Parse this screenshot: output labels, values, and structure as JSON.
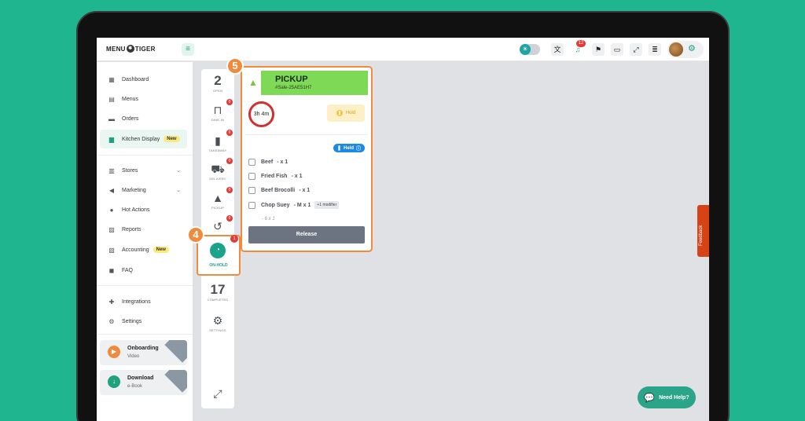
{
  "app": {
    "logo_left": "MENU",
    "logo_right": "TIGER"
  },
  "topbar": {
    "notification_count": "12",
    "icons": [
      "theme-toggle-icon",
      "translate-icon",
      "bell-icon",
      "flag-icon",
      "devices-icon",
      "fullscreen-icon",
      "document-icon",
      "settings-icon"
    ]
  },
  "sidebar": {
    "items": [
      {
        "label": "Dashboard",
        "icon": "dashboard-icon"
      },
      {
        "label": "Menus",
        "icon": "menus-icon"
      },
      {
        "label": "Orders",
        "icon": "orders-icon"
      },
      {
        "label": "Kitchen Display",
        "icon": "kitchen-icon",
        "badge": "New",
        "active": true
      },
      {
        "label": "Stores",
        "icon": "stores-icon"
      },
      {
        "label": "Marketing",
        "icon": "marketing-icon"
      },
      {
        "label": "Hot Actions",
        "icon": "hot-actions-icon"
      },
      {
        "label": "Reports",
        "icon": "reports-icon"
      },
      {
        "label": "Accounting",
        "icon": "accounting-icon",
        "badge": "New"
      },
      {
        "label": "FAQ",
        "icon": "faq-icon"
      },
      {
        "label": "Integrations",
        "icon": "integrations-icon"
      },
      {
        "label": "Settings",
        "icon": "settings-icon"
      }
    ],
    "promos": [
      {
        "title": "Onboarding",
        "subtitle": "Video"
      },
      {
        "title": "Download",
        "subtitle": "e-Book"
      }
    ]
  },
  "kitchen": {
    "open_count": "2",
    "open_label": "OPEN",
    "dinein_label": "DINE-IN",
    "takeaway_label": "TAKEAWAY",
    "delivery_label": "DELIVERY",
    "pickup_label": "PICKUP",
    "onhold_label": "ON-HOLD",
    "onhold_count": "1",
    "completed_count": "17",
    "completed_label": "COMPLETED",
    "settings_label": "SETTINGS",
    "badges": [
      "0",
      "0",
      "0",
      "0",
      "0"
    ]
  },
  "steps": {
    "four": "4",
    "five": "5"
  },
  "order": {
    "type": "PICKUP",
    "sale_id": "#Sale-25AE51H7",
    "timer": "3h 4m",
    "hold_label": "Hold",
    "held_label": "Held",
    "items": [
      {
        "name": "Beef",
        "qty": "- x 1"
      },
      {
        "name": "Fried Fish",
        "qty": "- x 1"
      },
      {
        "name": "Beef Brocolli",
        "qty": "- x 1"
      },
      {
        "name": "Chop Suey",
        "qty": "- M x 1",
        "modifier": "+1 modifier"
      }
    ],
    "item_note": "- 6 x 1",
    "release_label": "Release"
  },
  "feedback_label": "Feedback",
  "help_label": "Need Help?"
}
